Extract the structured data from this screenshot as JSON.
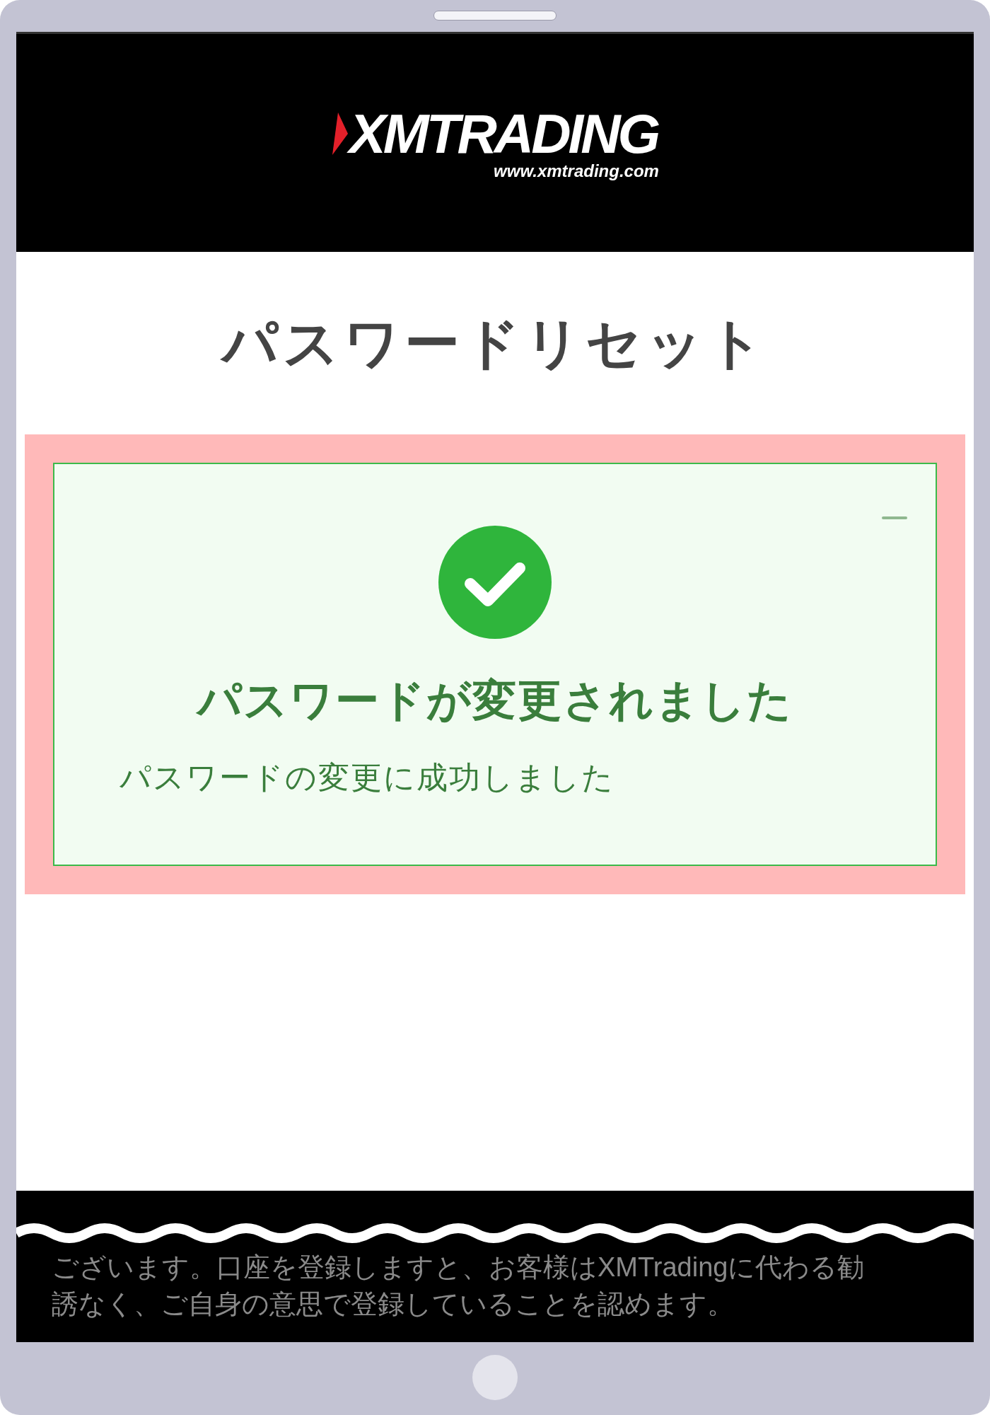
{
  "header": {
    "logo": "XMTRADING",
    "url": "www.xmtrading.com"
  },
  "title": "パスワードリセット",
  "alert": {
    "heading": "パスワードが変更されました",
    "message": "パスワードの変更に成功しました",
    "collapsed": false
  },
  "footer": {
    "lines": [
      "ございます。口座を登録しますと、お客様はXMTradingに代わる勧",
      "誘なく、ご自身の意思で登録していることを認めます。"
    ]
  }
}
